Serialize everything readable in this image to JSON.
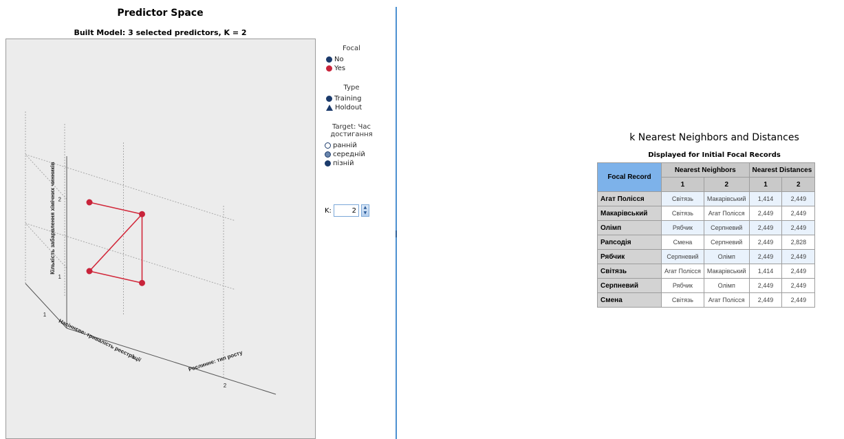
{
  "chart_data": {
    "type": "scatter",
    "title": "Predictor Space",
    "subtitle": "Built Model: 3 selected predictors, K = 2",
    "axes": {
      "z_label": "Кількість забарвлення хімічних чинників",
      "x_label": "Насіннєве: тривалість реєстрації",
      "y_label": "Рослинне: тип росту",
      "z_ticks": [
        "1",
        "2"
      ],
      "x_ticks": [
        "1"
      ],
      "y_ticks": [
        "1",
        "2"
      ]
    },
    "points": [
      {
        "focal": "Yes",
        "type": "Training",
        "x": 1,
        "y": 1,
        "z": 2
      },
      {
        "focal": "Yes",
        "type": "Training",
        "x": 2,
        "y": 2,
        "z": 2
      },
      {
        "focal": "Yes",
        "type": "Training",
        "x": 1,
        "y": 1,
        "z": 1
      },
      {
        "focal": "Yes",
        "type": "Training",
        "x": 2,
        "y": 2,
        "z": 1
      }
    ],
    "legend": {
      "focal_title": "Focal",
      "focal_items": [
        {
          "label": "No",
          "color": "#1b3a6b"
        },
        {
          "label": "Yes",
          "color": "#c8233a"
        }
      ],
      "type_title": "Type",
      "type_items": [
        {
          "label": "Training",
          "shape": "circle"
        },
        {
          "label": "Holdout",
          "shape": "triangle"
        }
      ],
      "target_title_1": "Target: Час",
      "target_title_2": "достигання",
      "target_items": [
        {
          "label": "ранній",
          "color": "#ffffff"
        },
        {
          "label": "середній",
          "color": "#6a86ad"
        },
        {
          "label": "пізній",
          "color": "#1b3a6b"
        }
      ]
    }
  },
  "k_control": {
    "label": "K:",
    "value": "2"
  },
  "knn": {
    "title": "k Nearest Neighbors and Distances",
    "subtitle": "Displayed for Initial Focal Records",
    "header": {
      "focal_record": "Focal Record",
      "nearest_neighbors": "Nearest Neighbors",
      "nearest_distances": "Nearest Distances",
      "n1": "1",
      "n2": "2",
      "d1": "1",
      "d2": "2"
    },
    "rows": [
      {
        "focal": "Агат Полісся",
        "n1": "Світязь",
        "n2": "Макарівський",
        "d1": "1,414",
        "d2": "2,449"
      },
      {
        "focal": "Макарівський",
        "n1": "Світязь",
        "n2": "Агат Полісся",
        "d1": "2,449",
        "d2": "2,449"
      },
      {
        "focal": "Олімп",
        "n1": "Рябчик",
        "n2": "Серпневий",
        "d1": "2,449",
        "d2": "2,449"
      },
      {
        "focal": "Рапсодія",
        "n1": "Смена",
        "n2": "Серпневий",
        "d1": "2,449",
        "d2": "2,828"
      },
      {
        "focal": "Рябчик",
        "n1": "Серпневий",
        "n2": "Олімп",
        "d1": "2,449",
        "d2": "2,449"
      },
      {
        "focal": "Світязь",
        "n1": "Агат Полісся",
        "n2": "Макарівський",
        "d1": "1,414",
        "d2": "2,449"
      },
      {
        "focal": "Серпневий",
        "n1": "Рябчик",
        "n2": "Олімп",
        "d1": "2,449",
        "d2": "2,449"
      },
      {
        "focal": "Смена",
        "n1": "Світязь",
        "n2": "Агат Полісся",
        "d1": "2,449",
        "d2": "2,449"
      }
    ]
  }
}
